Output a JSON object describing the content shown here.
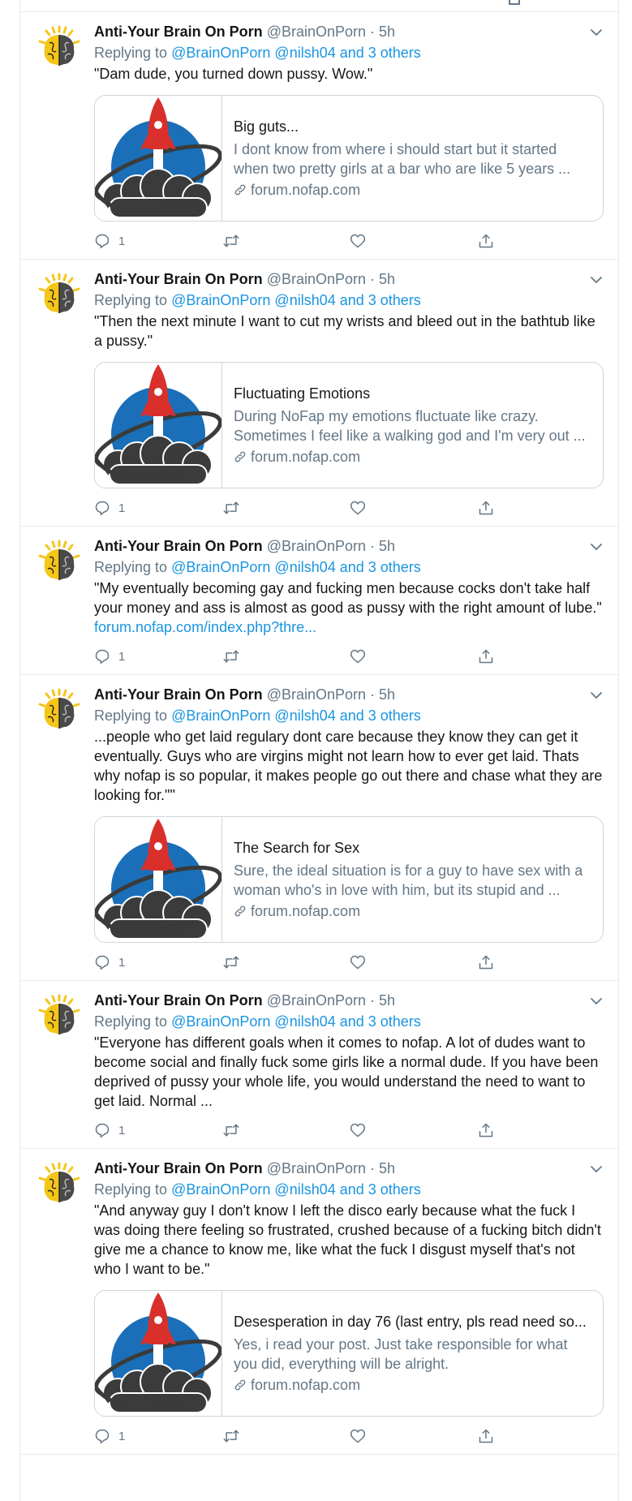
{
  "colors": {
    "accent": "#1b95e0",
    "secondary_text": "#657786",
    "border": "#e6ecf0"
  },
  "tweets": [
    {
      "name": "Anti-Your Brain On Porn",
      "handle": "@BrainOnPorn",
      "sep": "·",
      "time": "5h",
      "replying_label": "Replying to",
      "mention1": "@BrainOnPorn",
      "mention2": "@nilsh04 and 3 others",
      "text": "\"Dam dude, you turned down pussy. Wow.\"",
      "card": {
        "title": "Big guts...",
        "description": "I dont know from where i should start but it started when two pretty girls at a bar who are like 5 years ...",
        "domain": "forum.nofap.com"
      },
      "reply_count": "1"
    },
    {
      "name": "Anti-Your Brain On Porn",
      "handle": "@BrainOnPorn",
      "sep": "·",
      "time": "5h",
      "replying_label": "Replying to",
      "mention1": "@BrainOnPorn",
      "mention2": "@nilsh04 and 3 others",
      "text": "\"Then the next minute I want to cut my wrists and bleed out in the bathtub like a pussy.\"",
      "card": {
        "title": "Fluctuating Emotions",
        "description": "During NoFap my emotions fluctuate like crazy. Sometimes I feel like a walking god and I'm very out ...",
        "domain": "forum.nofap.com"
      },
      "reply_count": "1"
    },
    {
      "name": "Anti-Your Brain On Porn",
      "handle": "@BrainOnPorn",
      "sep": "·",
      "time": "5h",
      "replying_label": "Replying to",
      "mention1": "@BrainOnPorn",
      "mention2": "@nilsh04 and 3 others",
      "text": "\"My eventually becoming gay and fucking men because cocks don't take half your money and ass is almost as good as pussy with the right amount of lube.\"",
      "link": "forum.nofap.com/index.php?thre...",
      "reply_count": "1"
    },
    {
      "name": "Anti-Your Brain On Porn",
      "handle": "@BrainOnPorn",
      "sep": "·",
      "time": "5h",
      "replying_label": "Replying to",
      "mention1": "@BrainOnPorn",
      "mention2": "@nilsh04 and 3 others",
      "text": "...people who get laid regulary dont care because they know they can get it eventually. Guys who are virgins might not learn how to ever get laid. Thats why nofap is so popular, it makes people go out there and chase what they are looking for.\"\"",
      "card": {
        "title": "The Search for Sex",
        "description": "Sure, the ideal situation is for a guy to have sex with a woman who's in love with him, but its stupid and ...",
        "domain": "forum.nofap.com"
      },
      "reply_count": "1"
    },
    {
      "name": "Anti-Your Brain On Porn",
      "handle": "@BrainOnPorn",
      "sep": "·",
      "time": "5h",
      "replying_label": "Replying to",
      "mention1": "@BrainOnPorn",
      "mention2": "@nilsh04 and 3 others",
      "text": "\"Everyone has different goals when it comes to nofap. A lot of dudes want to become social and finally fuck some girls like a normal dude. If you have been deprived of pussy your whole life, you would understand the need to want to get laid. Normal ...",
      "reply_count": "1"
    },
    {
      "name": "Anti-Your Brain On Porn",
      "handle": "@BrainOnPorn",
      "sep": "·",
      "time": "5h",
      "replying_label": "Replying to",
      "mention1": "@BrainOnPorn",
      "mention2": "@nilsh04 and 3 others",
      "text": "\"And anyway guy I don't know I left the disco early because what the fuck I was doing there feeling so frustrated, crushed because of a fucking bitch didn't give me a chance to know me, like what the fuck I disgust myself that's not who I want to be.\"",
      "card": {
        "title": "Desesperation in day 76 (last entry, pls read need so...",
        "description": "Yes, i read your post. Just take responsible for what you did, everything will be alright.",
        "domain": "forum.nofap.com"
      },
      "reply_count": "1"
    }
  ]
}
